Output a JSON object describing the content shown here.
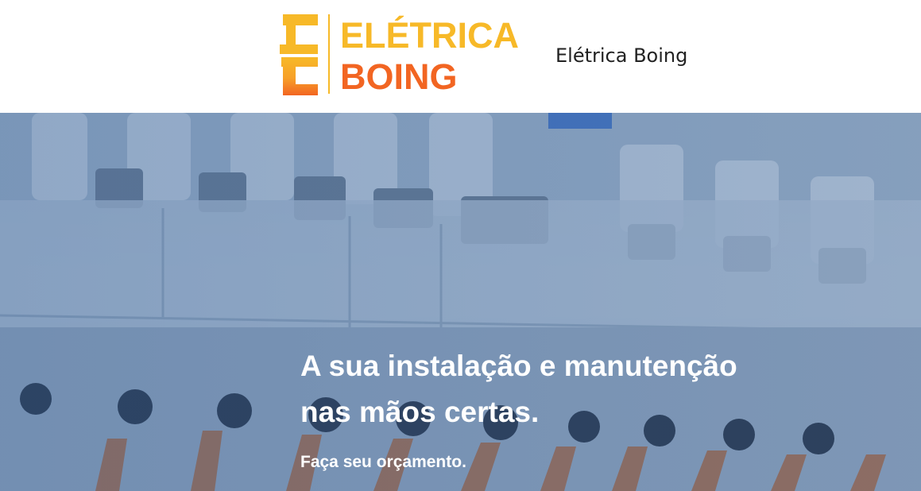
{
  "header": {
    "logo": {
      "line1": "ELÉTRICA",
      "line2": "BOING",
      "color_top": "#f7b928",
      "color_bottom": "#f26522"
    },
    "site_title": "Elétrica Boing"
  },
  "hero": {
    "heading_line1": "A sua instalação e manutenção",
    "heading_line2": "nas mãos certas.",
    "cta": "Faça seu orçamento.",
    "overlay_color": "#2a5a9a"
  },
  "colors": {
    "text_dark": "#222222",
    "text_light": "#ffffff"
  }
}
